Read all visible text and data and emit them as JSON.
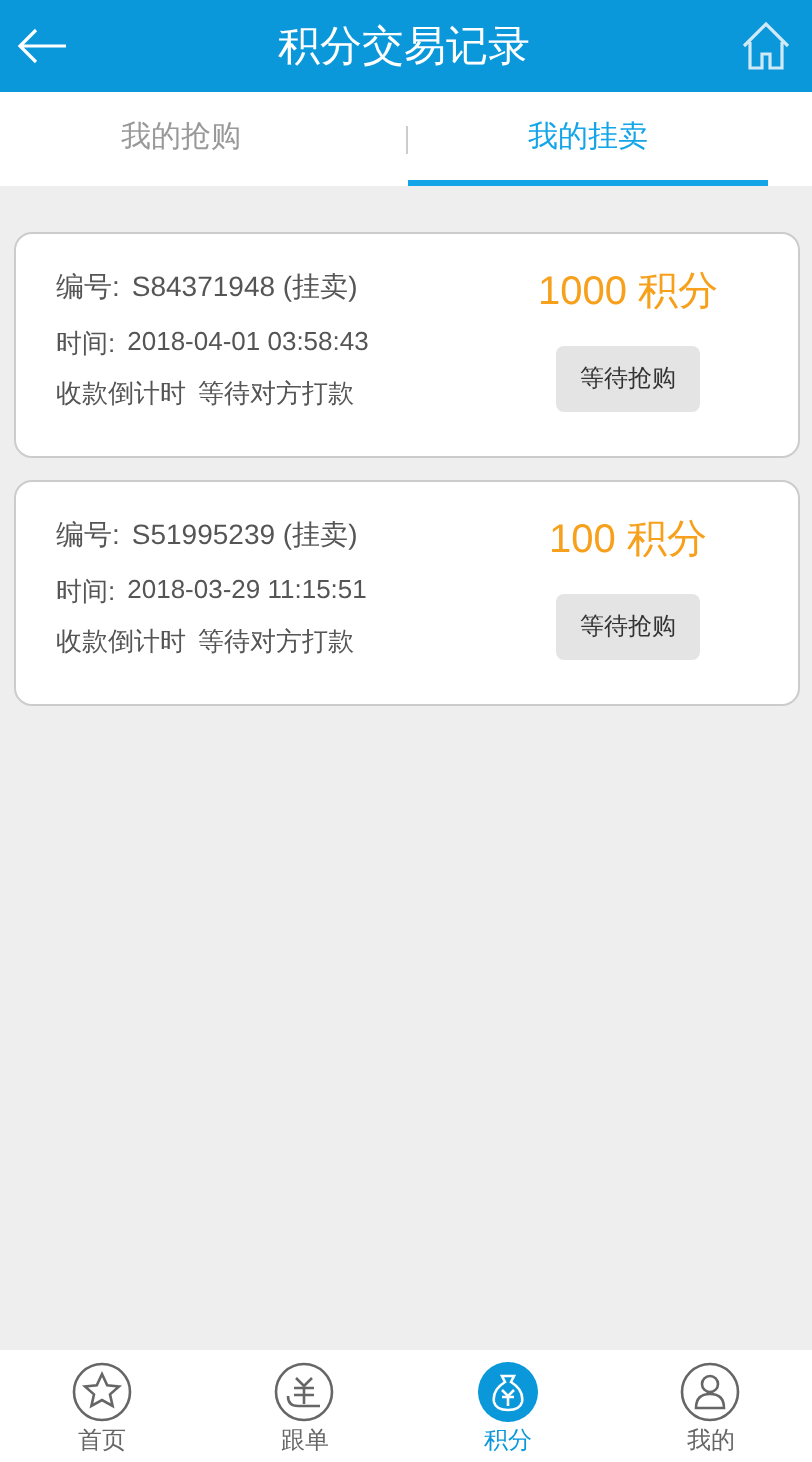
{
  "header": {
    "title": "积分交易记录"
  },
  "tabs": [
    {
      "label": "我的抢购",
      "selected": false
    },
    {
      "label": "我的挂卖",
      "selected": true
    }
  ],
  "records": [
    {
      "number_label": "编号:",
      "number": "S84371948 (挂卖)",
      "points": "1000 积分",
      "time_label": "时间:",
      "time": "2018-04-01 03:58:43",
      "countdown_label": "收款倒计时",
      "countdown": "等待对方打款",
      "button": "等待抢购"
    },
    {
      "number_label": "编号:",
      "number": "S51995239 (挂卖)",
      "points": "100 积分",
      "time_label": "时间:",
      "time": "2018-03-29 11:15:51",
      "countdown_label": "收款倒计时",
      "countdown": "等待对方打款",
      "button": "等待抢购"
    }
  ],
  "nav": [
    {
      "kind": "star",
      "label": "首页",
      "selected": false
    },
    {
      "kind": "yen",
      "label": "跟单",
      "selected": false
    },
    {
      "kind": "bag",
      "label": "积分",
      "selected": true
    },
    {
      "kind": "person",
      "label": "我的",
      "selected": false
    }
  ]
}
